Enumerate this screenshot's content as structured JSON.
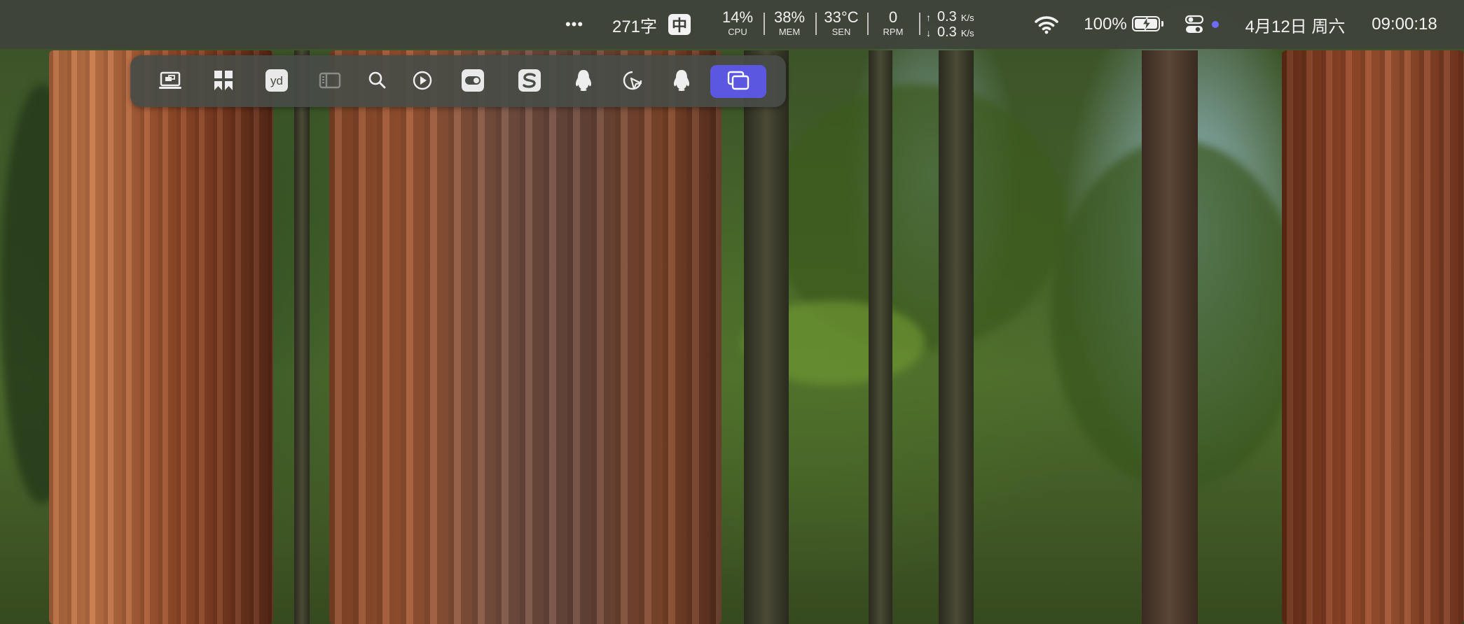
{
  "menubar": {
    "more_label": "•••",
    "word_count": "271字",
    "ime_label": "中",
    "cpu": {
      "value": "14%",
      "label": "CPU"
    },
    "mem": {
      "value": "38%",
      "label": "MEM"
    },
    "sen": {
      "value": "33°C",
      "label": "SEN"
    },
    "rpm": {
      "value": "0",
      "label": "RPM"
    },
    "network": {
      "up_value": "0.3",
      "down_value": "0.3",
      "unit": "K/s",
      "up_arrow": "↑",
      "down_arrow": "↓"
    },
    "battery_percent": "100%",
    "battery_level": 1.0,
    "date": "4月12日 周六",
    "time": "09:00:18",
    "accent_color": "#6e6cf5"
  },
  "toolbar": {
    "items": [
      {
        "icon": "screen-mirroring-icon"
      },
      {
        "icon": "bookmark-app-icon"
      },
      {
        "icon": "youdao-dict-icon",
        "text": "yd"
      },
      {
        "icon": "sidebar-icon"
      },
      {
        "icon": "search-icon"
      },
      {
        "icon": "play-circle-icon"
      },
      {
        "icon": "toggle-app-icon"
      },
      {
        "icon": "sogou-input-icon"
      },
      {
        "icon": "qq-penguin-icon"
      },
      {
        "icon": "cursor-pie-icon"
      },
      {
        "icon": "qq-penguin-icon"
      },
      {
        "icon": "window-switcher-icon",
        "active": true
      }
    ],
    "active_color": "#5b57e0"
  }
}
